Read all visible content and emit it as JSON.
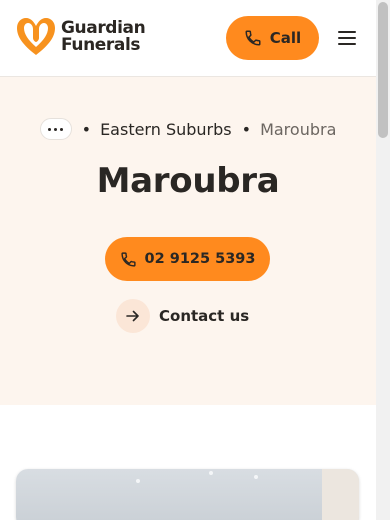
{
  "header": {
    "logo_line1": "Guardian",
    "logo_line2": "Funerals",
    "call_label": "Call",
    "menu_icon": "hamburger-menu-icon"
  },
  "breadcrumb": {
    "items": [
      "Eastern Suburbs",
      "Maroubra"
    ],
    "separator": "•"
  },
  "page": {
    "title": "Maroubra",
    "phone": "02 9125 5393",
    "contact_label": "Contact us"
  },
  "colors": {
    "accent": "#ff8a1e",
    "hero_bg": "#fdf5ee",
    "text": "#2a2724"
  }
}
